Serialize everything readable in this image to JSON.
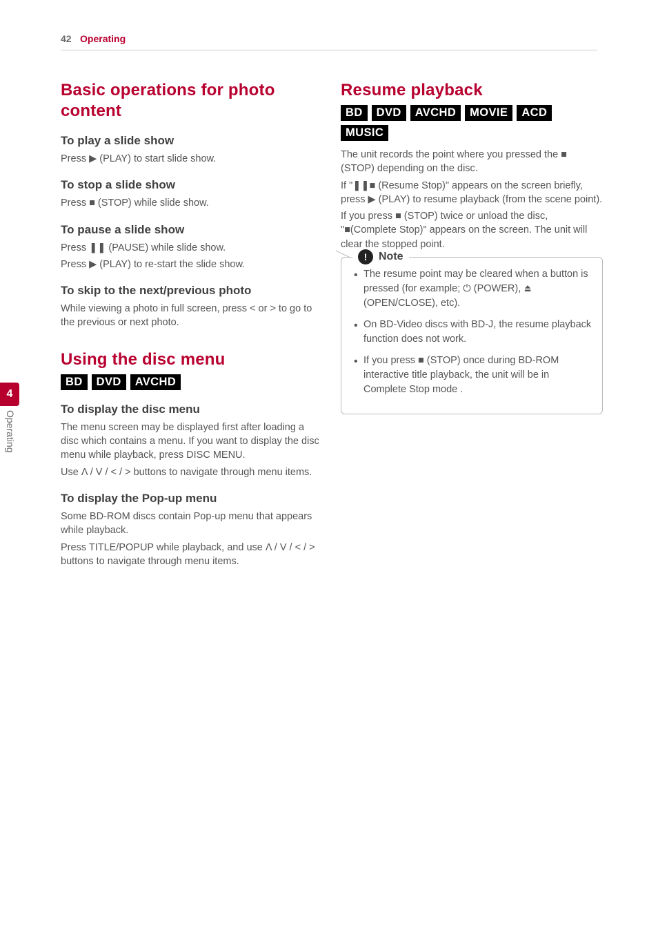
{
  "header": {
    "page_number": "42",
    "section": "Operating"
  },
  "side": {
    "number": "4",
    "label": "Operating"
  },
  "left": {
    "h1": "Basic operations for photo content",
    "s1_title": "To play a slide show",
    "s1_body": "Press ▶ (PLAY) to start slide show.",
    "s2_title": "To stop a slide show",
    "s2_body": "Press ■ (STOP) while slide show.",
    "s3_title": "To pause a slide show",
    "s3_body_a": "Press ❚❚ (PAUSE) while slide show.",
    "s3_body_b": "Press ▶ (PLAY) to re-start the slide show.",
    "s4_title": "To skip to the next/previous photo",
    "s4_body": "While viewing a photo in full screen, press < or > to go to the previous or next photo.",
    "h2": "Using the disc menu",
    "tags1": [
      "BD",
      "DVD",
      "AVCHD"
    ],
    "s5_title": "To display the disc menu",
    "s5_body_a": "The menu screen may be displayed first after loading a disc which contains a menu. If you want to display the disc menu while playback, press DISC MENU.",
    "s5_body_b": "Use Λ / V / < / > buttons to navigate through menu items.",
    "s6_title": "To display the Pop-up menu",
    "s6_body_a": "Some BD-ROM discs contain Pop-up menu that appears while playback.",
    "s6_body_b": "Press TITLE/POPUP while playback, and use Λ / V / < / > buttons to navigate through menu items."
  },
  "right": {
    "h1": "Resume playback",
    "tags1": [
      "BD",
      "DVD",
      "AVCHD",
      "MOVIE",
      "ACD",
      "MUSIC"
    ],
    "p1": "The unit records the point where you pressed the ■ (STOP) depending on the disc.",
    "p2": "If \"❚❚■ (Resume Stop)\" appears on the screen briefly, press ▶ (PLAY) to resume playback (from the scene point).",
    "p3": "If you press ■ (STOP) twice or unload the disc, \"■(Complete Stop)\" appears on the screen. The unit will clear the stopped point.",
    "note_title": "Note",
    "note_items": [
      "The resume point may be cleared when a button is pressed (for example; ⏻ (POWER), ⏏ (OPEN/CLOSE), etc).",
      "On BD-Video discs with BD-J, the resume playback function does not work.",
      "If you press ■ (STOP) once during BD-ROM interactive title playback, the unit will be in Complete Stop mode ."
    ]
  }
}
